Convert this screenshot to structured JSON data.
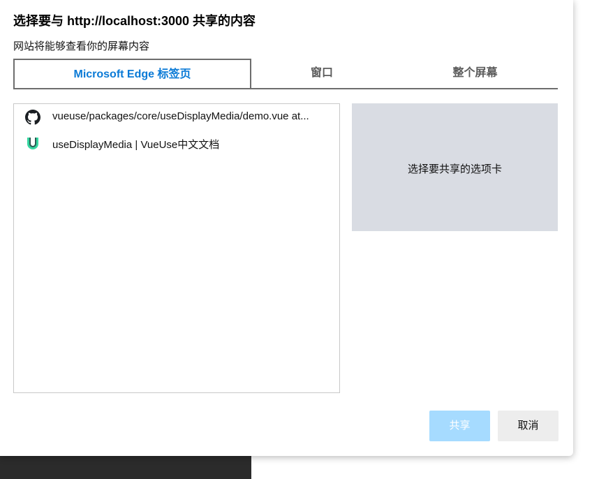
{
  "dialog": {
    "title": "选择要与 http://localhost:3000 共享的内容",
    "subtitle": "网站将能够查看你的屏幕内容"
  },
  "tabs": [
    {
      "label": "Microsoft Edge 标签页",
      "active": true
    },
    {
      "label": "窗口",
      "active": false
    },
    {
      "label": "整个屏幕",
      "active": false
    }
  ],
  "tab_list": [
    {
      "icon": "github-icon",
      "label": "vueuse/packages/core/useDisplayMedia/demo.vue at..."
    },
    {
      "icon": "vueuse-icon",
      "label": "useDisplayMedia | VueUse中文文档"
    }
  ],
  "preview": {
    "placeholder": "选择要共享的选项卡"
  },
  "buttons": {
    "share": "共享",
    "cancel": "取消"
  },
  "colors": {
    "active_tab": "#0a7ad6",
    "share_button_disabled": "#a6dbff",
    "preview_bg": "#d9dce3"
  }
}
